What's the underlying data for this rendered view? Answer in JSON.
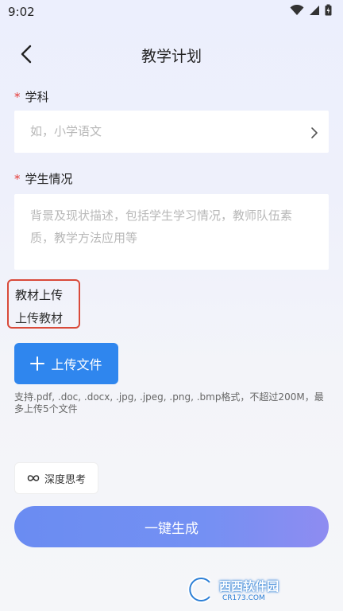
{
  "status_bar": {
    "time": "9:02"
  },
  "header": {
    "title": "教学计划"
  },
  "subject": {
    "required_mark": "*",
    "label": "学科",
    "placeholder": "如，小学语文"
  },
  "student": {
    "required_mark": "*",
    "label": "学生情况",
    "placeholder": "背景及现状描述，包括学生学习情况，教师队伍素质，教学方法应用等"
  },
  "material": {
    "title": "教材上传",
    "subtitle": "上传教材",
    "upload_button": "上传文件",
    "hint": "支持.pdf, .doc, .docx, .jpg, .jpeg, .png, .bmp格式，不超过200M，最多上传5个文件"
  },
  "deep_think": {
    "label": "深度思考"
  },
  "generate": {
    "label": "一键生成"
  },
  "watermark": {
    "text": "西西软件园",
    "sub": "CR173.COM"
  },
  "colors": {
    "accent": "#2f86ee",
    "required": "#e53935",
    "highlight_box": "#d94a3a"
  }
}
